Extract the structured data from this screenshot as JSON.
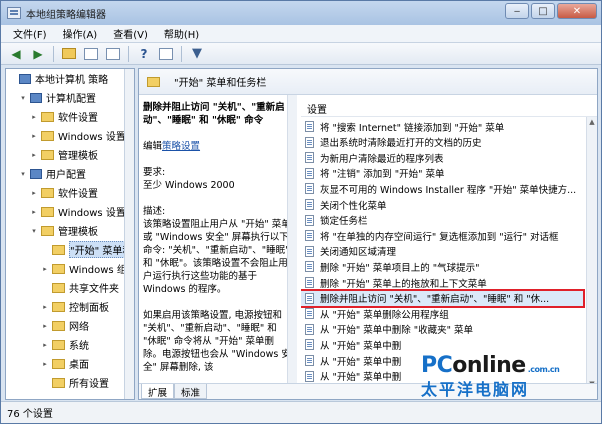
{
  "window": {
    "title": "本地组策略编辑器",
    "controls": {
      "minimize": "‒",
      "maximize": "□",
      "close": "✕"
    }
  },
  "menu": [
    "文件(F)",
    "操作(A)",
    "查看(V)",
    "帮助(H)"
  ],
  "toolbar": {
    "icons": [
      "back-icon",
      "forward-icon",
      "up-folder-icon",
      "show-hide-tree-icon",
      "export-icon",
      "help-icon",
      "properties-icon",
      "filter-icon"
    ]
  },
  "tree": {
    "items": [
      {
        "label": "本地计算机 策略",
        "level": 0,
        "twisty": "",
        "icon": "pc"
      },
      {
        "label": "计算机配置",
        "level": 1,
        "twisty": "▾",
        "icon": "pc"
      },
      {
        "label": "软件设置",
        "level": 2,
        "twisty": "▸",
        "icon": "folder"
      },
      {
        "label": "Windows 设置",
        "level": 2,
        "twisty": "▸",
        "icon": "folder"
      },
      {
        "label": "管理模板",
        "level": 2,
        "twisty": "▸",
        "icon": "folder"
      },
      {
        "label": "用户配置",
        "level": 1,
        "twisty": "▾",
        "icon": "pc"
      },
      {
        "label": "软件设置",
        "level": 2,
        "twisty": "▸",
        "icon": "folder"
      },
      {
        "label": "Windows 设置",
        "level": 2,
        "twisty": "▸",
        "icon": "folder"
      },
      {
        "label": "管理模板",
        "level": 2,
        "twisty": "▾",
        "icon": "folder"
      },
      {
        "label": "\"开始\" 菜单和任",
        "level": 3,
        "twisty": "",
        "icon": "folder",
        "selected": true
      },
      {
        "label": "Windows 组件",
        "level": 3,
        "twisty": "▸",
        "icon": "folder"
      },
      {
        "label": "共享文件夹",
        "level": 3,
        "twisty": "",
        "icon": "folder"
      },
      {
        "label": "控制面板",
        "level": 3,
        "twisty": "▸",
        "icon": "folder"
      },
      {
        "label": "网络",
        "level": 3,
        "twisty": "▸",
        "icon": "folder"
      },
      {
        "label": "系统",
        "level": 3,
        "twisty": "▸",
        "icon": "folder"
      },
      {
        "label": "桌面",
        "level": 3,
        "twisty": "▸",
        "icon": "folder"
      },
      {
        "label": "所有设置",
        "level": 3,
        "twisty": "",
        "icon": "folder"
      }
    ]
  },
  "right_pane": {
    "header": "\"开始\" 菜单和任务栏",
    "description": {
      "title": "删除并阻止访问 \"关机\"、\"重新启动\"、\"睡眠\" 和 \"休眠\" 命令",
      "edit_prefix": "编辑",
      "edit_link": "策略设置",
      "req_label": "要求:",
      "req_value": "至少 Windows 2000",
      "desc_label": "描述:",
      "desc_text": "该策略设置阻止用户从 \"开始\" 菜单或 \"Windows 安全\" 屏幕执行以下命令: \"关机\"、\"重新启动\"、\"睡眠\" 和 \"休眠\"。该策略设置不会阻止用户运行执行这些功能的基于 Windows 的程序。",
      "enable_text": "如果启用该策略设置, 电源按钮和 \"关机\"、\"重新启动\"、\"睡眠\" 和 \"休眠\" 命令将从 \"开始\" 菜单删除。电源按钮也会从 \"Windows 安全\" 屏幕删除, 该"
    },
    "list_header": "设置",
    "settings": [
      "将 \"搜索 Internet\" 链接添加到 \"开始\" 菜单",
      "退出系统时清除最近打开的文档的历史",
      "为新用户清除最近的程序列表",
      "将 \"注销\" 添加到 \"开始\" 菜单",
      "灰显不可用的 Windows Installer 程序 \"开始\" 菜单快捷方...",
      "关闭个性化菜单",
      "锁定任务栏",
      "将 \"在单独的内存空间运行\" 复选框添加到 \"运行\" 对话框",
      "关闭通知区域清理",
      "删除 \"开始\" 菜单项目上的 \"气球提示\"",
      "删除 \"开始\" 菜单上的拖放和上下文菜单",
      "删除并阻止访问 \"关机\"、\"重新启动\"、\"睡眠\" 和 \"休...",
      "从 \"开始\" 菜单删除公用程序组",
      "从 \"开始\" 菜单中删除 \"收藏夹\" 菜单",
      "从 \"开始\" 菜单中删",
      "从 \"开始\" 菜单中删",
      "从 \"开始\" 菜单中删"
    ],
    "highlighted_index": 11,
    "tabs": [
      "扩展",
      "标准"
    ]
  },
  "status": {
    "text": "76 个设置"
  },
  "watermark": {
    "brand_a": "PC",
    "brand_b": "online",
    "domain": ".com.cn",
    "cn": "太平洋电脑网"
  },
  "colors": {
    "highlight_border": "#e0202a",
    "link": "#1b52a8",
    "brand": "#1670c8"
  }
}
